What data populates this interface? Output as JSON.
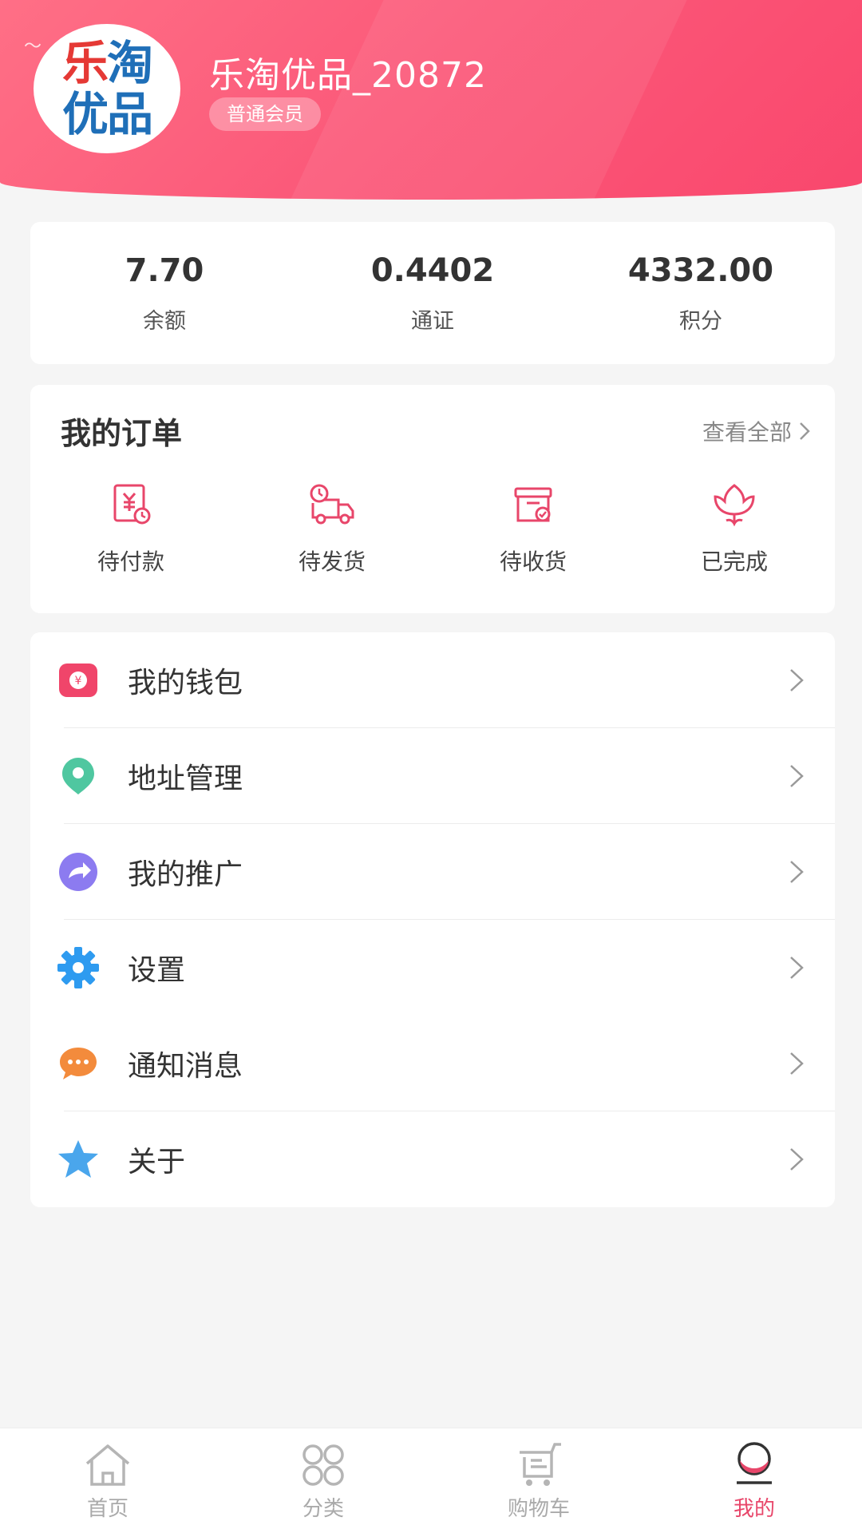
{
  "header": {
    "avatar_logo_line1_a": "乐",
    "avatar_logo_line1_b": "淘",
    "avatar_logo_line2": "优品",
    "username": "乐淘优品_20872",
    "member_level": "普通会员",
    "gradient_start": "#ff6f86",
    "gradient_end": "#f9476d"
  },
  "stats": [
    {
      "value": "7.70",
      "label": "余额"
    },
    {
      "value": "0.4402",
      "label": "通证"
    },
    {
      "value": "4332.00",
      "label": "积分"
    }
  ],
  "orders": {
    "title": "我的订单",
    "view_all": "查看全部",
    "items": [
      {
        "label": "待付款",
        "icon": "pending-payment-icon"
      },
      {
        "label": "待发货",
        "icon": "pending-shipment-icon"
      },
      {
        "label": "待收货",
        "icon": "pending-receipt-icon"
      },
      {
        "label": "已完成",
        "icon": "completed-icon"
      }
    ],
    "accent_color": "#e8466a"
  },
  "menu": [
    {
      "label": "我的钱包",
      "icon": "wallet-icon",
      "color": "#f0456a"
    },
    {
      "label": "地址管理",
      "icon": "location-pin-icon",
      "color": "#4fc7a0"
    },
    {
      "label": "我的推广",
      "icon": "share-arrow-icon",
      "color": "#8c7bf0"
    },
    {
      "label": "设置",
      "icon": "gear-icon",
      "color": "#2e9bf0"
    },
    {
      "label": "通知消息",
      "icon": "chat-bubble-icon",
      "color": "#f38b3c"
    },
    {
      "label": "关于",
      "icon": "star-icon",
      "color": "#4aa6ec"
    }
  ],
  "bottom_nav": [
    {
      "label": "首页",
      "icon": "home-icon",
      "active": false
    },
    {
      "label": "分类",
      "icon": "category-icon",
      "active": false
    },
    {
      "label": "购物车",
      "icon": "cart-icon",
      "active": false
    },
    {
      "label": "我的",
      "icon": "profile-icon",
      "active": true
    }
  ],
  "active_color": "#e8466a",
  "inactive_color": "#aaaaaa"
}
